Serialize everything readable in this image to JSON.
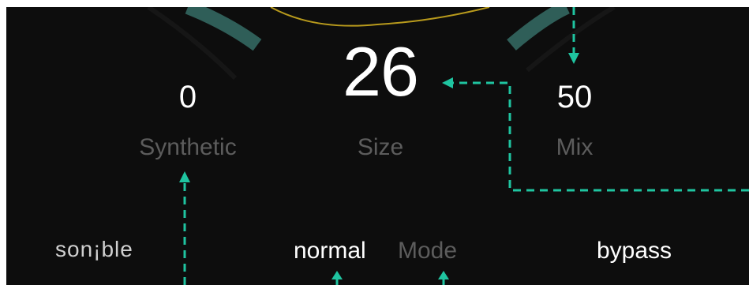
{
  "controls": {
    "synthetic": {
      "value": "0",
      "label": "Synthetic"
    },
    "size": {
      "value": "26",
      "label": "Size"
    },
    "mix": {
      "value": "50",
      "label": "Mix"
    }
  },
  "footer": {
    "logo": "son¡ble",
    "mode_value": "normal",
    "mode_label": "Mode",
    "bypass": "bypass"
  },
  "colors": {
    "panel_bg": "#0d0d0d",
    "value_text": "#ffffff",
    "label_text": "#5c5c5c",
    "annotation": "#1fc4a0",
    "arc_teal": "#2f5e58",
    "curve_yellow": "#b89a1c"
  }
}
